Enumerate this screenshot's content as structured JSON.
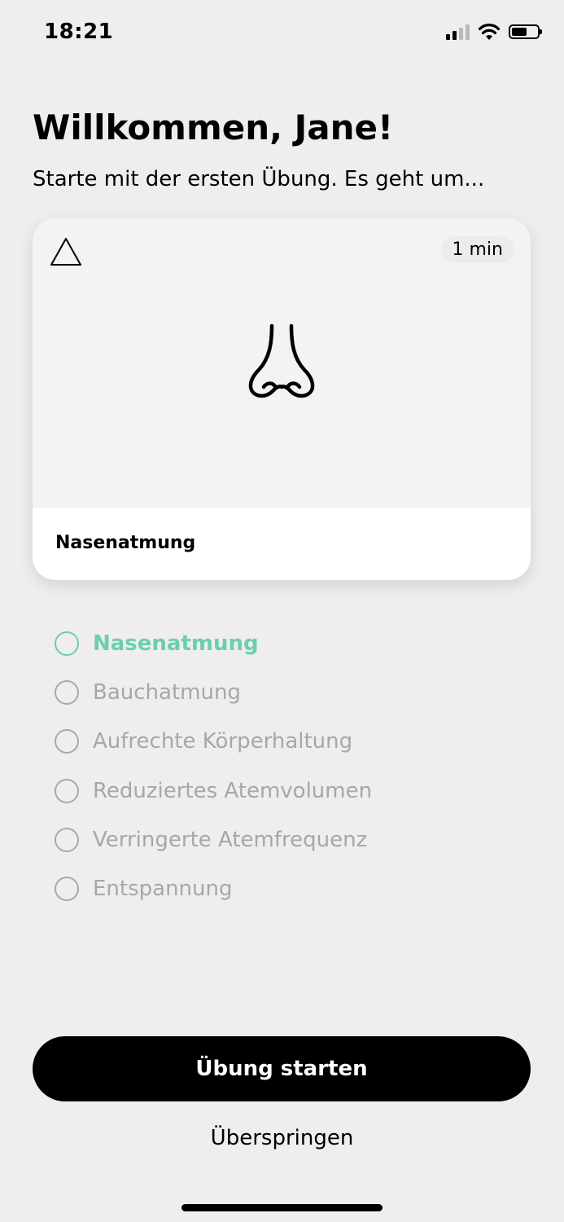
{
  "status_bar": {
    "time": "18:21",
    "battery_level": 0.6
  },
  "header": {
    "title": "Willkommen, Jane!",
    "subtitle": "Starte mit der ersten Übung. Es geht um..."
  },
  "card": {
    "duration": "1 min",
    "label": "Nasenatmung",
    "icons": [
      "warning-triangle-icon",
      "nose-icon"
    ]
  },
  "steps": [
    {
      "label": "Nasenatmung",
      "active": true
    },
    {
      "label": "Bauchatmung",
      "active": false
    },
    {
      "label": "Aufrechte Körperhaltung",
      "active": false
    },
    {
      "label": "Reduziertes Atemvolumen",
      "active": false
    },
    {
      "label": "Verringerte Atemfrequenz",
      "active": false
    },
    {
      "label": "Entspannung",
      "active": false
    }
  ],
  "actions": {
    "start_label": "Übung starten",
    "skip_label": "Überspringen"
  },
  "colors": {
    "accent": "#6ccfac",
    "background": "#efeeec",
    "inactive": "#a7a7a7",
    "button": "#000000"
  }
}
